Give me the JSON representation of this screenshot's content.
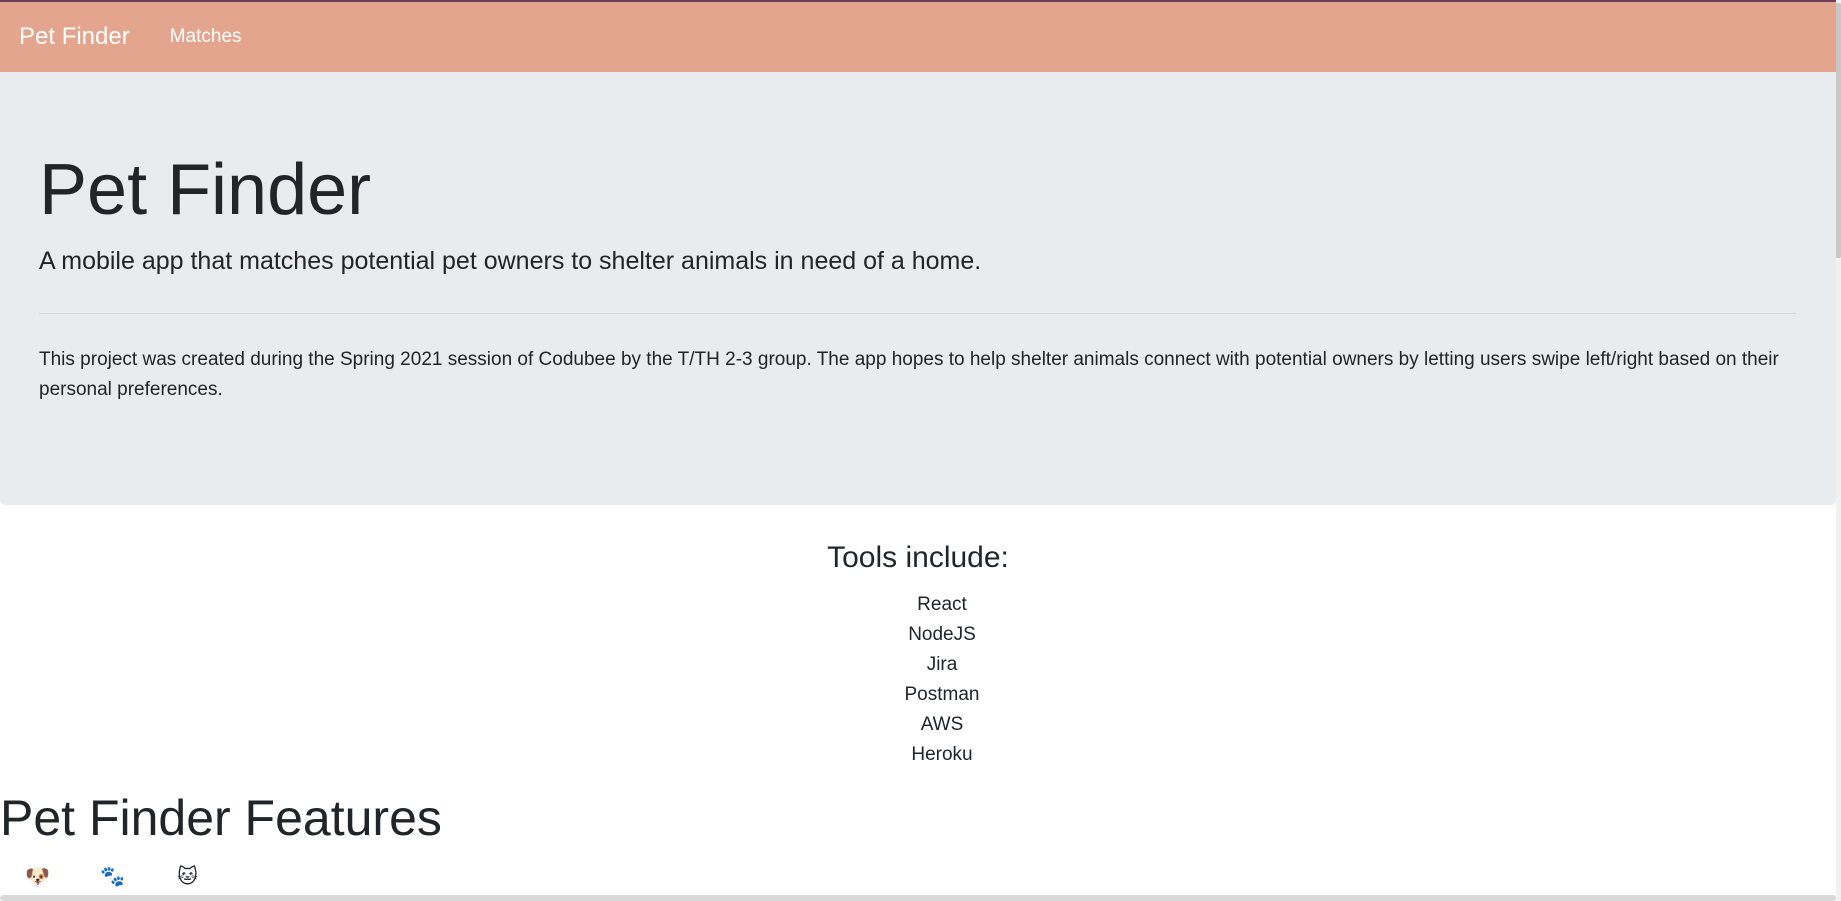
{
  "navbar": {
    "brand": "Pet Finder",
    "links": [
      {
        "label": "Matches"
      }
    ],
    "background": "#e4a58e"
  },
  "jumbotron": {
    "title": "Pet Finder",
    "lead": "A mobile app that matches potential pet owners to shelter animals in need of a home.",
    "description": "This project was created during the Spring 2021 session of Codubee by the T/TH 2-3 group. The app hopes to help shelter animals connect with potential owners by letting users swipe left/right based on their personal preferences.",
    "background": "#e9ecef"
  },
  "tools": {
    "heading": "Tools include:",
    "items": [
      "React",
      "NodeJS",
      "Jira",
      "Postman",
      "AWS",
      "Heroku"
    ]
  },
  "features": {
    "heading": "Pet Finder Features",
    "tabs": [
      {
        "icon": "dog-face-icon",
        "glyph": "🐶"
      },
      {
        "icon": "paw-prints-icon",
        "glyph": "🐾"
      },
      {
        "icon": "cat-face-icon",
        "glyph": "🐱"
      }
    ]
  }
}
